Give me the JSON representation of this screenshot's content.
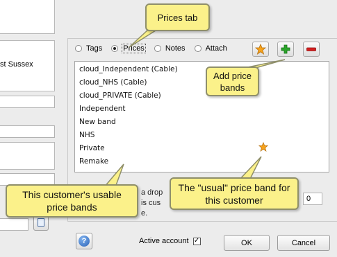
{
  "left_panel": {
    "address_fragment": "st Sussex"
  },
  "tabs": [
    {
      "label": "Tags",
      "selected": false
    },
    {
      "label": "Prices",
      "selected": true
    },
    {
      "label": "Notes",
      "selected": false
    },
    {
      "label": "Attach",
      "selected": false
    }
  ],
  "toolbar": {
    "star_icon": "star-icon",
    "add_icon": "plus-icon",
    "remove_icon": "minus-icon",
    "colors": {
      "star": "#f7a21b",
      "add": "#2aa52a",
      "remove": "#d42020"
    }
  },
  "price_bands": [
    {
      "label": "cloud_Independent (Cable)",
      "usual": false
    },
    {
      "label": "cloud_NHS (Cable)",
      "usual": false
    },
    {
      "label": "cloud_PRIVATE (Cable)",
      "usual": false
    },
    {
      "label": "Independent",
      "usual": false
    },
    {
      "label": "New band",
      "usual": false
    },
    {
      "label": "NHS",
      "usual": false
    },
    {
      "label": "Private",
      "usual": true
    },
    {
      "label": "Remake",
      "usual": false
    }
  ],
  "callouts": {
    "prices_tab": "Prices tab",
    "add_bands": "Add price bands",
    "usable_bands": "This customer's usable price bands",
    "usual_band": "The \"usual\" price band for this customer",
    "color": "#fbf18a"
  },
  "obscured": {
    "line1": "a drop",
    "line2": "is cus",
    "line3": "e.",
    "number_value": "0"
  },
  "footer": {
    "help_icon": "question-icon",
    "active_label": "Active account",
    "active_checked": true,
    "ok_label": "OK",
    "cancel_label": "Cancel"
  }
}
